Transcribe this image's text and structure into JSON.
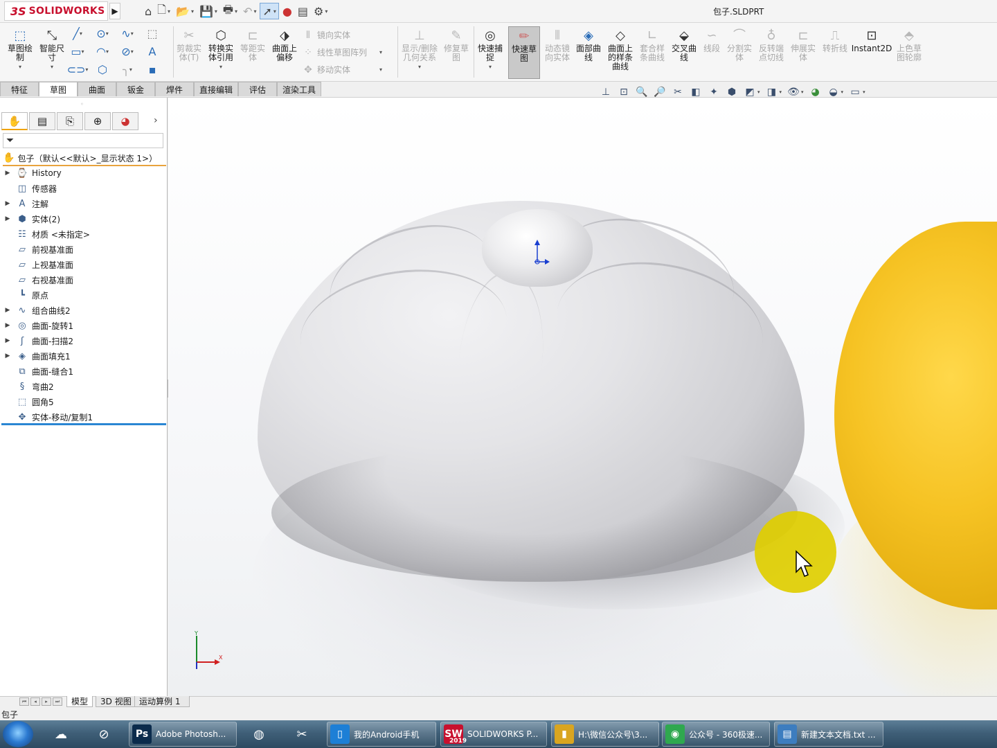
{
  "app": {
    "logo_text": "SOLIDWORKS",
    "document_title": "包子.SLDPRT"
  },
  "ribbon": {
    "sketch_label": "草图绘\n制",
    "smart_dim_label": "智能尺\n寸",
    "trim_label": "剪裁实\n体(T)",
    "convert_label": "转换实\n体引用",
    "offset_label": "等距实\n体",
    "offset_surface_label": "曲面上\n偏移",
    "mirror_label": "镜向实体",
    "linear_pattern_label": "线性草图阵列",
    "move_label": "移动实体",
    "display_relations_label": "显示/删除\n几何关系",
    "repair_label": "修复草\n图",
    "quick_snap_label": "快速捕\n捉",
    "rapid_sketch_label": "快速草\n图",
    "dynamic_mirror_label": "动态镜\n向实体",
    "section_curve_label": "面部曲\n线",
    "spline_on_surface_label": "曲面上\n的样条\n曲线",
    "fit_spline_label": "套合样\n条曲线",
    "intersection_curve_label": "交叉曲\n线",
    "segment_label": "线段",
    "split_label": "分割实\n体",
    "reverse_tangent_label": "反转端\n点切线",
    "stretch_label": "伸展实\n体",
    "polyline_label": "转折线",
    "instant2d_label": "Instant2D",
    "shaded_label": "上色草\n图轮廓"
  },
  "tabs": [
    "特征",
    "草图",
    "曲面",
    "钣金",
    "焊件",
    "直接编辑",
    "评估",
    "渲染工具"
  ],
  "active_tab": "草图",
  "feature_tree": {
    "root": "包子（默认<<默认>_显示状态 1>）",
    "items": [
      {
        "label": "History",
        "icon": "history-icon",
        "expandable": true
      },
      {
        "label": "传感器",
        "icon": "sensor-icon",
        "expandable": false
      },
      {
        "label": "注解",
        "icon": "annotation-icon",
        "expandable": true
      },
      {
        "label": "实体(2)",
        "icon": "solid-bodies-icon",
        "expandable": true
      },
      {
        "label": "材质 <未指定>",
        "icon": "material-icon",
        "expandable": false
      },
      {
        "label": "前视基准面",
        "icon": "plane-icon",
        "expandable": false
      },
      {
        "label": "上视基准面",
        "icon": "plane-icon",
        "expandable": false
      },
      {
        "label": "右视基准面",
        "icon": "plane-icon",
        "expandable": false
      },
      {
        "label": "原点",
        "icon": "origin-icon",
        "expandable": false
      },
      {
        "label": "组合曲线2",
        "icon": "composite-curve-icon",
        "expandable": true
      },
      {
        "label": "曲面-旋转1",
        "icon": "revolve-surface-icon",
        "expandable": true
      },
      {
        "label": "曲面-扫描2",
        "icon": "sweep-surface-icon",
        "expandable": true
      },
      {
        "label": "曲面填充1",
        "icon": "fill-surface-icon",
        "expandable": true
      },
      {
        "label": "曲面-缝合1",
        "icon": "knit-surface-icon",
        "expandable": false
      },
      {
        "label": "弯曲2",
        "icon": "flex-icon",
        "expandable": false
      },
      {
        "label": "圆角5",
        "icon": "fillet-icon",
        "expandable": false
      },
      {
        "label": "实体-移动/复制1",
        "icon": "move-copy-icon",
        "expandable": false
      }
    ]
  },
  "bottom_tabs": [
    "模型",
    "3D 视图",
    "运动算例 1"
  ],
  "status_text": "包子",
  "taskbar": {
    "buttons": [
      {
        "label": "Adobe Photosh...",
        "icon_text": "Ps",
        "color": "#0b2b4c"
      },
      {
        "label": "我的Android手机",
        "icon_text": "▯",
        "color": "#1d7fd6"
      },
      {
        "label": "SOLIDWORKS P...",
        "icon_text": "SW",
        "color": "#c8102e"
      },
      {
        "label": "H:\\微信公众号\\3...",
        "icon_text": "▮",
        "color": "#d9a520"
      },
      {
        "label": "公众号 - 360极速...",
        "icon_text": "◉",
        "color": "#2fa84f"
      },
      {
        "label": "新建文本文档.txt ...",
        "icon_text": "▤",
        "color": "#3d7dbf"
      }
    ],
    "sw_badge": "2019"
  },
  "colors": {
    "accent_orange": "#f0a300",
    "tree_end_bar": "#2a86d3",
    "logo_red": "#c8102e",
    "cursor_highlight": "#e0ce00",
    "yellow_model": "#f6c324"
  }
}
